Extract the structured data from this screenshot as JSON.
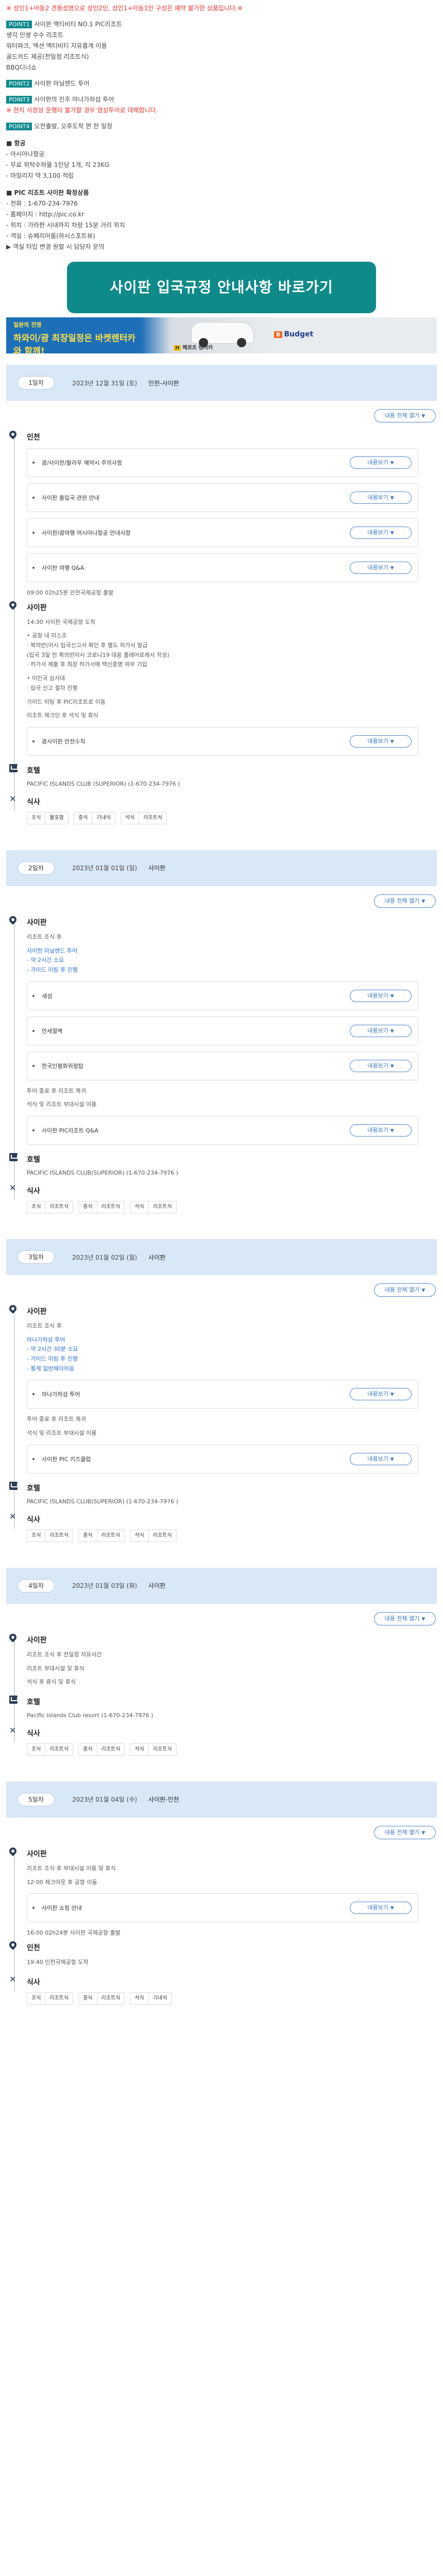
{
  "notes": {
    "warning": "※ 성인1+아동2 견용성명으로 성인2인, 성인1+아동1인 구성은 예약 불가한 상품입니다.※",
    "points": [
      {
        "badge": "POINT1",
        "lines": [
          "사이판 액티비티 NO.1 PIC리조트",
          "생각 인생 수수 리조트",
          "워터파크, 액션 액티비티 자유롭게 이용",
          "골드카드 제공(전일정 리조트식)",
          "BBQ디너쇼"
        ]
      },
      {
        "badge": "POINT2",
        "lines": [
          "사이판 마닐랜드 투어"
        ]
      },
      {
        "badge": "POINT3",
        "lines": [
          "사이판의 진주 마나가하섬 투어",
          "※ 현지 사정상 운행이 불가할 경우 영상투어로 대체합니다."
        ]
      },
      {
        "badge": "POINT4",
        "lines": [
          "오전출발, 오후도착 편 한 일정"
        ]
      }
    ],
    "flight_title": "■ 항공",
    "flight_lines": [
      "- 아시아나항공",
      "- 무료 위탁수하물 1인당 1개, 각 23KG",
      "- 마일리지 약 3,100 적립"
    ],
    "hotel_title": "■ PIC 리조트 사이판 확정상품",
    "hotel_lines": [
      "- 전화 : 1-670-234-7976",
      "- 홈페이지 : http://pic.co.kr",
      "- 위치 : 가라판 시내까지 차량 15분 거리 위치",
      "- 객실 : 슈페리어룸(하시스포트뷰)",
      "▶ 객실 타입 변경 원할 시 담당자 문의"
    ]
  },
  "cta": {
    "label": "사이판 입국규정 안내사항 바로가기"
  },
  "banner": {
    "small": "일본의 전쟁",
    "big": "하와이/괌 최장일정은 바켓렌터카와 함께!",
    "hertz": "헤르츠 렌터카",
    "budget": "Budget"
  },
  "ui": {
    "expand_all": "내용 전체 열기",
    "detail": "내용보기",
    "hotel_label": "호텔",
    "meal_label": "식사"
  },
  "days": [
    {
      "day": "1일차",
      "date": "2023년 12월 31일 (토)",
      "route": "인천-사이판",
      "blocks": [
        {
          "place": "인천",
          "items": [
            "괌/사이판/팔라우 예약시 주의사항",
            "사이판 출입국 관련 안내",
            "사이판/괌여행 여시아나항공 안내사항",
            "사이판 여행 Q&A"
          ],
          "after": [
            "09:00 02h25분 인천국제공항 출발"
          ]
        },
        {
          "place": "사이판",
          "pre": [
            "14:30 사이판 국제공항 도착",
            "• 공항 내 미스조\n· 복의반(아시 입국신고서 확인 후 별도 허가서 발급\n(입국 3일 전 복의반이시 코로나19 대응 플래어로케서 작성)\n· 허가서 제출 후 최장 허가서에 택신증명 여부 기입",
            "• 이민국 심사대\n· 입국 신고 절차 진행",
            "가이드 미팅 후 PIC리조트로 이동",
            "리조트 체크인 후 석식 및 휴식"
          ],
          "items": [
            "괌사이판 안전수칙"
          ],
          "after": []
        }
      ],
      "hotel": "PACIFIC ISLANDS CLUB (SUPERIOR) (1-670-234-7976 )",
      "meals": [
        [
          "조식",
          "불포함"
        ],
        [
          "중식",
          "기내식"
        ],
        [
          "석식",
          "리조트식"
        ]
      ]
    },
    {
      "day": "2일차",
      "date": "2023년 01월 01일 (일)",
      "route": "사이판",
      "blocks": [
        {
          "place": "사이판",
          "pre": [
            "리조트 조식 후",
            "사이판 마닐랜드 투어\n- 약 2시간 소요\n- 가이드 미팅 후 진행"
          ],
          "items": [
            "새섬",
            "만세절벽",
            "한국인평화위령탑"
          ],
          "after": [
            "투어 종료 후 리조트 복귀",
            "석식 및 리조트 부대시설 이용"
          ]
        },
        {
          "place": "",
          "pre": [],
          "items": [
            "사이판 PIC리조트 Q&A"
          ],
          "after": []
        }
      ],
      "hotel": "PACIFIC ISLANDS CLUB(SUPERIOR) (1-670-234-7976 )",
      "meals": [
        [
          "조식",
          "리조트식"
        ],
        [
          "중식",
          "리조트식"
        ],
        [
          "석식",
          "리조트식"
        ]
      ]
    },
    {
      "day": "3일차",
      "date": "2023년 01월 02일 (월)",
      "route": "사이판",
      "blocks": [
        {
          "place": "사이판",
          "pre": [
            "리조트 조식 후",
            "마나가하섬 투어\n- 약 2시간 30분 소요\n- 가이드 미팅 후 진행\n- 통제 일반해이어음"
          ],
          "items": [
            "마나가하섬 투어"
          ],
          "after": [
            "투어 종료 후 리조트 복귀",
            "석식 및 리조트 부대시설 이용"
          ]
        },
        {
          "place": "",
          "pre": [],
          "items": [
            "사이판 PIC 키즈클럽"
          ],
          "after": []
        }
      ],
      "hotel": "PACIFIC ISLANDS CLUB(SUPERIOR) (1-670-234-7976 )",
      "meals": [
        [
          "조식",
          "리조트식"
        ],
        [
          "중식",
          "리조트식"
        ],
        [
          "석식",
          "리조트식"
        ]
      ]
    },
    {
      "day": "4일차",
      "date": "2023년 01월 03일 (화)",
      "route": "사이판",
      "blocks": [
        {
          "place": "사이판",
          "pre": [
            "리조트 조식 후 전일정 자유시간",
            "리조트 부대시설 및 휴식",
            "석식 후 휴식 및 휴식"
          ],
          "items": [],
          "after": []
        }
      ],
      "hotel": "Pacific Islands Club resort (1-670-234-7976 )",
      "meals": [
        [
          "조식",
          "리조트식"
        ],
        [
          "중식",
          "리조트식"
        ],
        [
          "석식",
          "리조트식"
        ]
      ]
    },
    {
      "day": "5일차",
      "date": "2023년 01월 04일 (수)",
      "route": "사이판-인천",
      "blocks": [
        {
          "place": "사이판",
          "pre": [
            "리조트 조식 후 부대시설 이용 및 휴식",
            "12:00 체크아웃 후 공항 이동"
          ],
          "items": [
            "사이판 쇼핑 안내"
          ],
          "after": [
            "16:00 02h24분 사이판 국제공항 출발"
          ]
        },
        {
          "place": "인천",
          "pre": [
            "19:40 인천국제공항 도착"
          ],
          "items": [],
          "after": []
        }
      ],
      "hotel": "",
      "meals": [
        [
          "조식",
          "리조트식"
        ],
        [
          "중식",
          "리조트식"
        ],
        [
          "석식",
          "기내식"
        ]
      ]
    }
  ]
}
